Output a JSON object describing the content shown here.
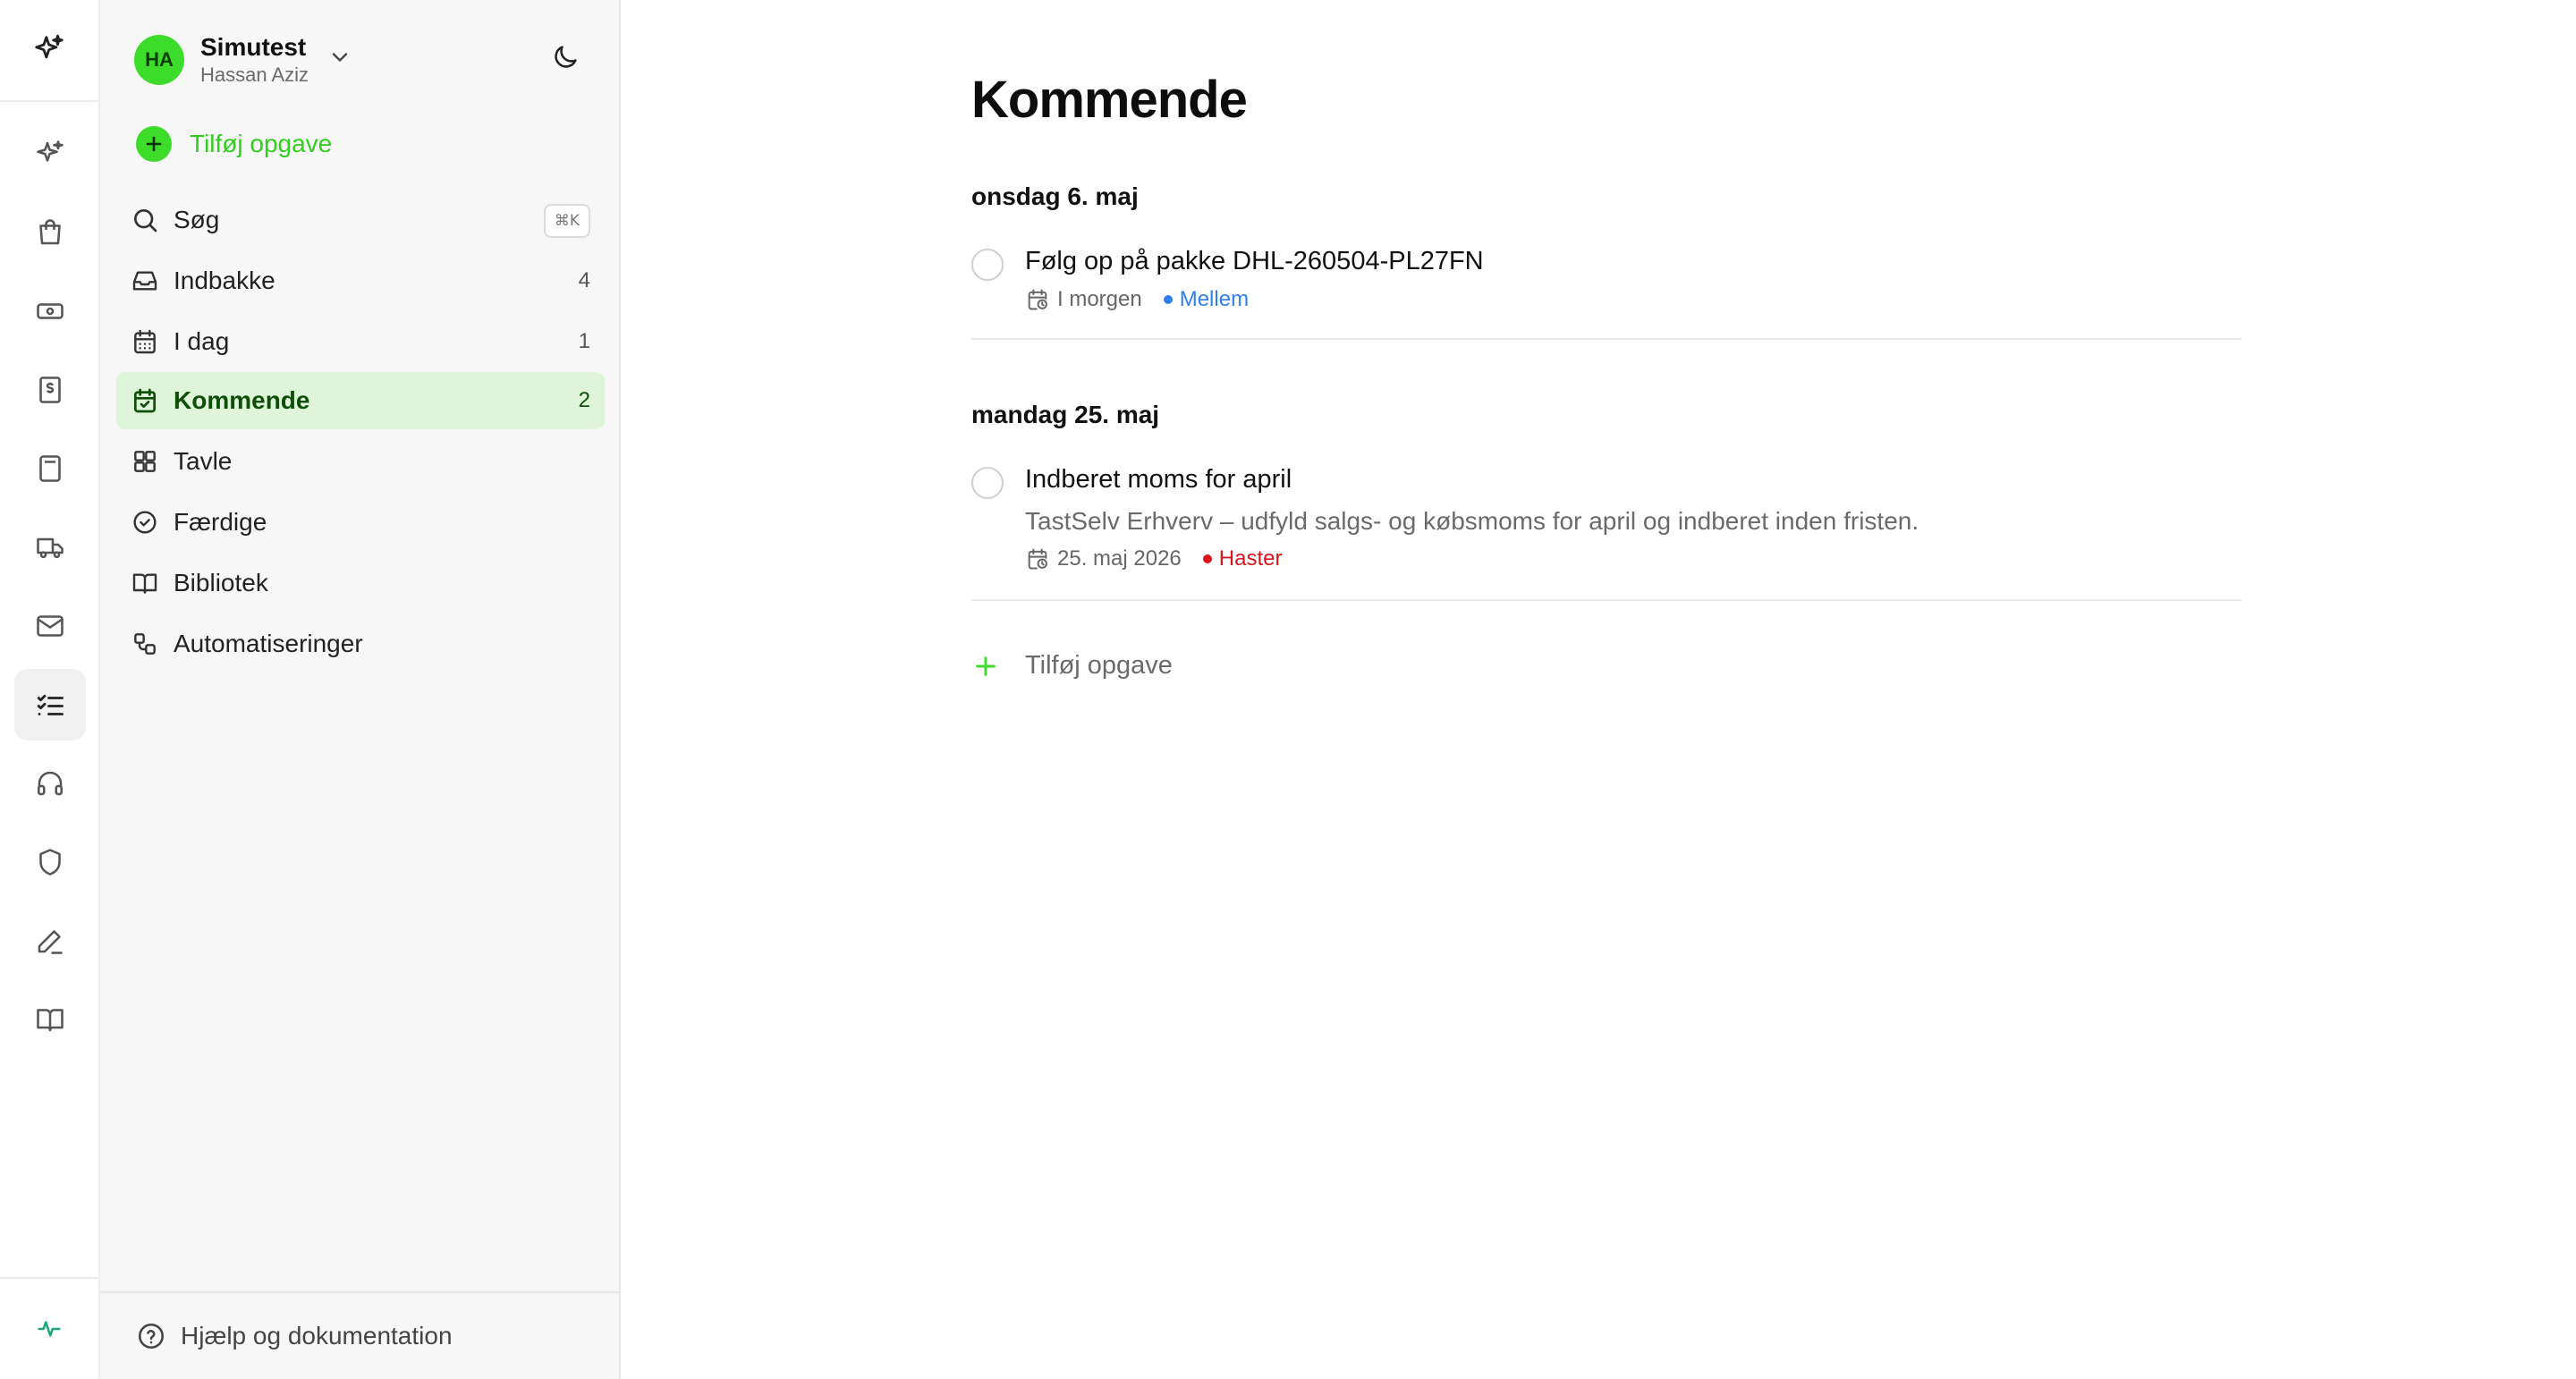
{
  "workspace": {
    "initials": "HA",
    "name": "Simutest",
    "user": "Hassan Aziz"
  },
  "sidebar": {
    "add_task_label": "Tilføj opgave",
    "search": {
      "label": "Søg",
      "shortcut": "⌘K"
    },
    "items": [
      {
        "label": "Indbakke",
        "count": "4",
        "icon": "inbox-icon"
      },
      {
        "label": "I dag",
        "count": "1",
        "icon": "calendar-icon"
      },
      {
        "label": "Kommende",
        "count": "2",
        "icon": "calendar-check-icon",
        "active": true
      },
      {
        "label": "Tavle",
        "count": "",
        "icon": "board-icon"
      },
      {
        "label": "Færdige",
        "count": "",
        "icon": "check-circle-icon"
      },
      {
        "label": "Bibliotek",
        "count": "",
        "icon": "book-icon"
      },
      {
        "label": "Automatiseringer",
        "count": "",
        "icon": "workflow-icon"
      }
    ],
    "footer_label": "Hjælp og dokumentation"
  },
  "rail": {
    "icons": [
      "sparkles-icon",
      "sparkles-icon",
      "shopping-bag-icon",
      "banknote-icon",
      "receipt-dollar-icon",
      "calculator-icon",
      "truck-icon",
      "mail-icon",
      "tasks-icon",
      "headphones-icon",
      "shield-icon",
      "pen-icon",
      "book-open-icon",
      "activity-icon"
    ],
    "active": "tasks-icon"
  },
  "main": {
    "title": "Kommende",
    "sections": [
      {
        "date": "onsdag 6. maj",
        "tasks": [
          {
            "title": "Følg op på pakke DHL-260504-PL27FN",
            "description": "",
            "due": "I morgen",
            "priority": "Mellem",
            "priority_color": "#2f80ed"
          }
        ]
      },
      {
        "date": "mandag 25. maj",
        "tasks": [
          {
            "title": "Indberet moms for april",
            "description": "TastSelv Erhverv – udfyld salgs- og købsmoms for april og indberet inden fristen.",
            "due": "25. maj 2026",
            "priority": "Haster",
            "priority_color": "#d9151b"
          }
        ]
      }
    ],
    "add_task_label": "Tilføj opgave"
  },
  "colors": {
    "accent": "#3ddc2a",
    "active_bg": "#dff5da",
    "active_text": "#0e4f08"
  }
}
